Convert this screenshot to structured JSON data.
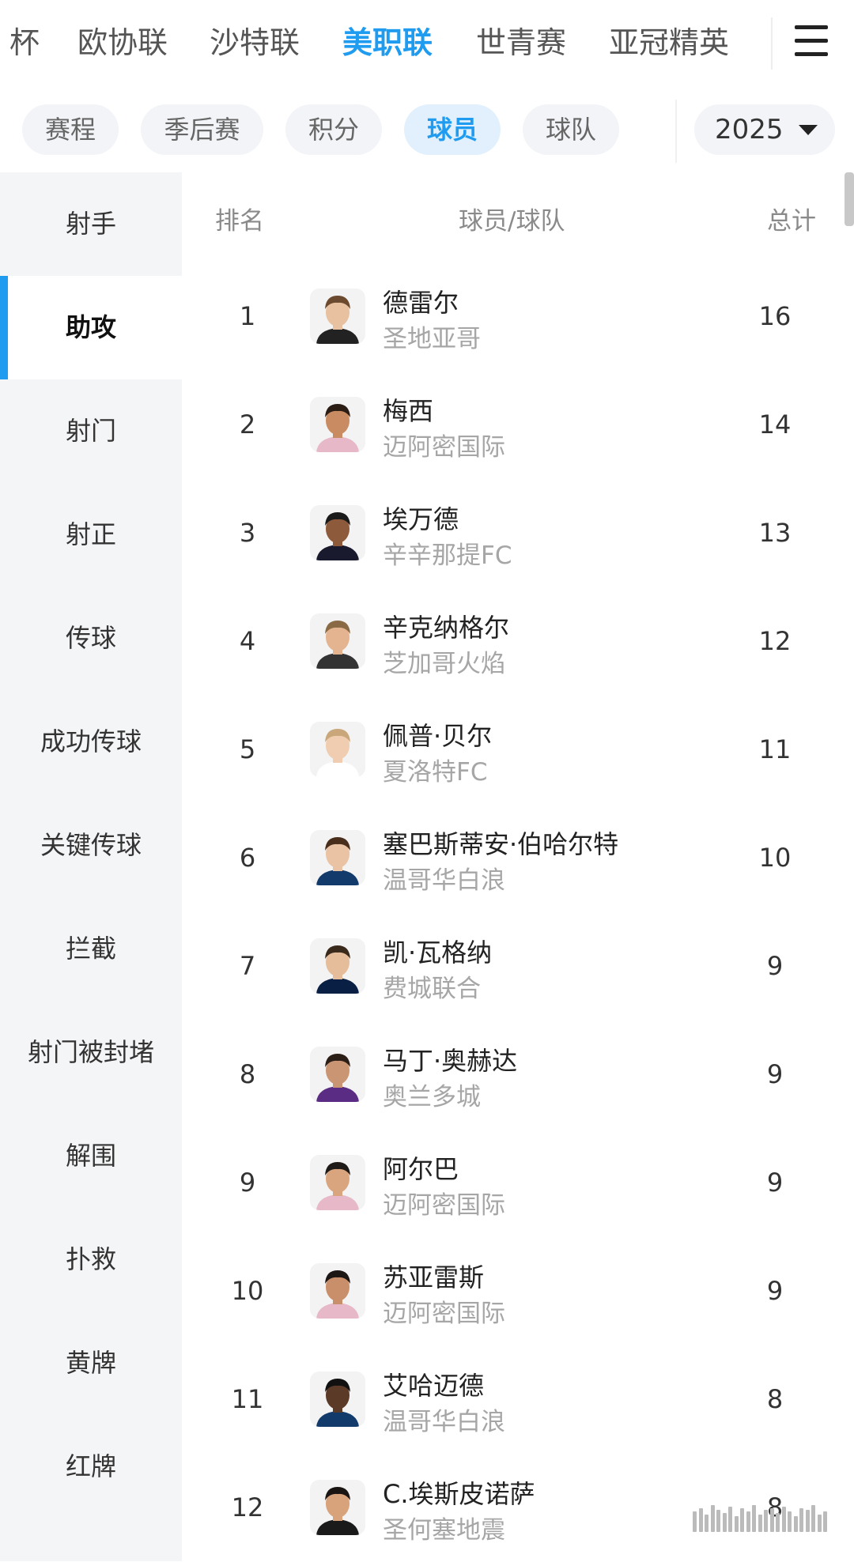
{
  "top_tabs": {
    "items": [
      "杯",
      "欧协联",
      "沙特联",
      "美职联",
      "世青赛",
      "亚冠精英"
    ],
    "active": "美职联"
  },
  "sub_tabs": {
    "items": [
      "赛程",
      "季后赛",
      "积分",
      "球员",
      "球队"
    ],
    "active": "球员"
  },
  "season_select": {
    "value": "2025"
  },
  "sidebar": {
    "items": [
      "射手",
      "助攻",
      "射门",
      "射正",
      "传球",
      "成功传球",
      "关键传球",
      "拦截",
      "射门被封堵",
      "解围",
      "扑救",
      "黄牌",
      "红牌"
    ],
    "active": "助攻"
  },
  "table": {
    "headers": {
      "rank": "排名",
      "player": "球员/球队",
      "total": "总计"
    },
    "rows": [
      {
        "rank": "1",
        "name": "德雷尔",
        "team": "圣地亚哥",
        "total": "16"
      },
      {
        "rank": "2",
        "name": "梅西",
        "team": "迈阿密国际",
        "total": "14"
      },
      {
        "rank": "3",
        "name": "埃万德",
        "team": "辛辛那提FC",
        "total": "13"
      },
      {
        "rank": "4",
        "name": "辛克纳格尔",
        "team": "芝加哥火焰",
        "total": "12"
      },
      {
        "rank": "5",
        "name": "佩普·贝尔",
        "team": "夏洛特FC",
        "total": "11"
      },
      {
        "rank": "6",
        "name": "塞巴斯蒂安·伯哈尔特",
        "team": "温哥华白浪",
        "total": "10"
      },
      {
        "rank": "7",
        "name": "凯·瓦格纳",
        "team": "费城联合",
        "total": "9"
      },
      {
        "rank": "8",
        "name": "马丁·奥赫达",
        "team": "奥兰多城",
        "total": "9"
      },
      {
        "rank": "9",
        "name": "阿尔巴",
        "team": "迈阿密国际",
        "total": "9"
      },
      {
        "rank": "10",
        "name": "苏亚雷斯",
        "team": "迈阿密国际",
        "total": "9"
      },
      {
        "rank": "11",
        "name": "艾哈迈德",
        "team": "温哥华白浪",
        "total": "8"
      },
      {
        "rank": "12",
        "name": "C.埃斯皮诺萨",
        "team": "圣何塞地震",
        "total": "8"
      }
    ]
  },
  "icons": {
    "menu": "hamburger-menu-icon",
    "dropdown": "caret-down-icon"
  },
  "colors": {
    "accent": "#1f9cf0",
    "active_pill_bg": "#e1f0fc",
    "sidebar_bg": "#f4f5f7",
    "muted_text": "#a6a6a6"
  }
}
